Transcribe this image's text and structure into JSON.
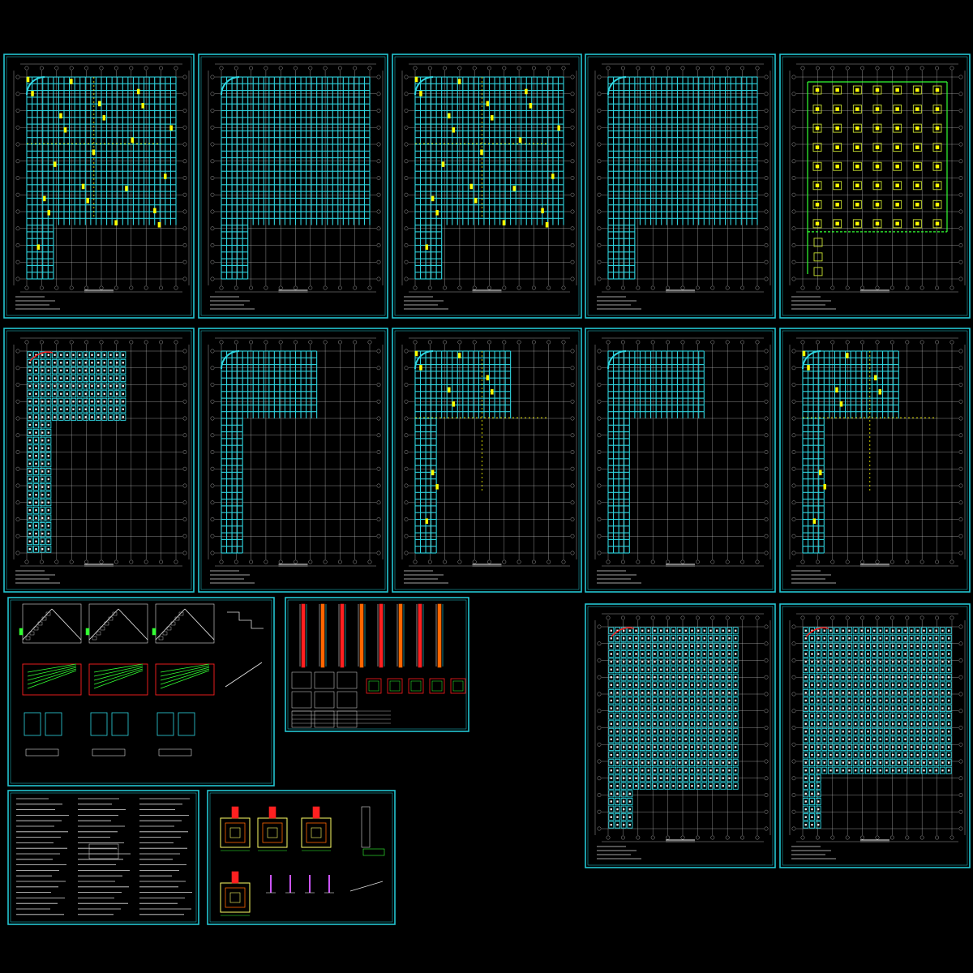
{
  "drawing_set": {
    "background": "#000000",
    "frame_color": "#23c5d2",
    "grid_color": "#c8c8c8",
    "slab_color": "#2fd5e0",
    "beam_color": "#ffff00",
    "rebar_color": "#ff2020",
    "annotation_color": "#33ff33",
    "accent_colors": [
      "#ff6600",
      "#cc55ff",
      "#ffffff"
    ]
  },
  "sheets": [
    {
      "kind": "beam-plan",
      "shape": "full"
    },
    {
      "kind": "slab-plan",
      "shape": "full"
    },
    {
      "kind": "beam-plan",
      "shape": "full"
    },
    {
      "kind": "slab-plan",
      "shape": "full"
    },
    {
      "kind": "pile-cap-plan",
      "shape": "full"
    },
    {
      "kind": "waffle-plan",
      "shape": "L"
    },
    {
      "kind": "slab-plan",
      "shape": "L"
    },
    {
      "kind": "beam-plan",
      "shape": "L"
    },
    {
      "kind": "slab-plan",
      "shape": "L"
    },
    {
      "kind": "beam-plan",
      "shape": "L"
    },
    {
      "kind": "stair-details"
    },
    {
      "kind": "column-schedule"
    },
    {
      "kind": "waffle-plan",
      "shape": "full-tail"
    },
    {
      "kind": "waffle-plan",
      "shape": "full-stair"
    },
    {
      "kind": "general-notes"
    },
    {
      "kind": "foundation-details"
    }
  ]
}
